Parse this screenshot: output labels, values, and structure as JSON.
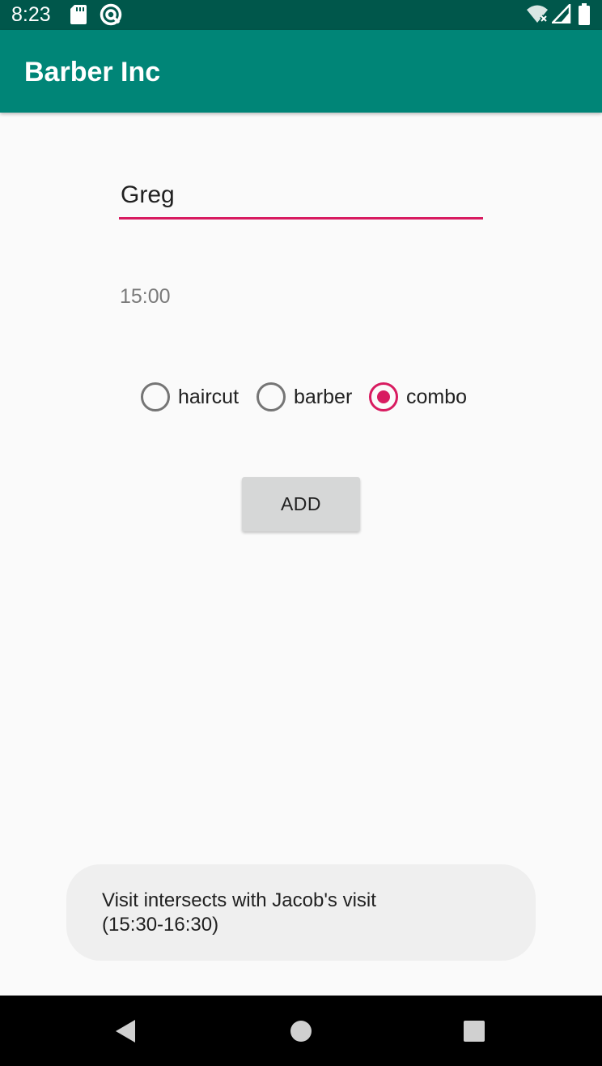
{
  "status_bar": {
    "time": "8:23",
    "icons": [
      "sd-card-icon",
      "at-sign-icon",
      "wifi-icon",
      "signal-icon",
      "battery-icon"
    ]
  },
  "app_bar": {
    "title": "Barber Inc"
  },
  "form": {
    "name_value": "Greg",
    "time_value": "15:00",
    "service_options": [
      {
        "label": "haircut",
        "checked": false
      },
      {
        "label": "barber",
        "checked": false
      },
      {
        "label": "combo",
        "checked": true
      }
    ],
    "add_label": "ADD"
  },
  "toast": {
    "line1": "Visit intersects with Jacob's visit",
    "line2": "(15:30-16:30)"
  },
  "nav_bar": {
    "icons": [
      "back-icon",
      "home-icon",
      "recents-icon"
    ]
  },
  "colors": {
    "status_bar": "#00574b",
    "app_bar": "#008577",
    "accent": "#d81b60",
    "background": "#fafafa"
  }
}
